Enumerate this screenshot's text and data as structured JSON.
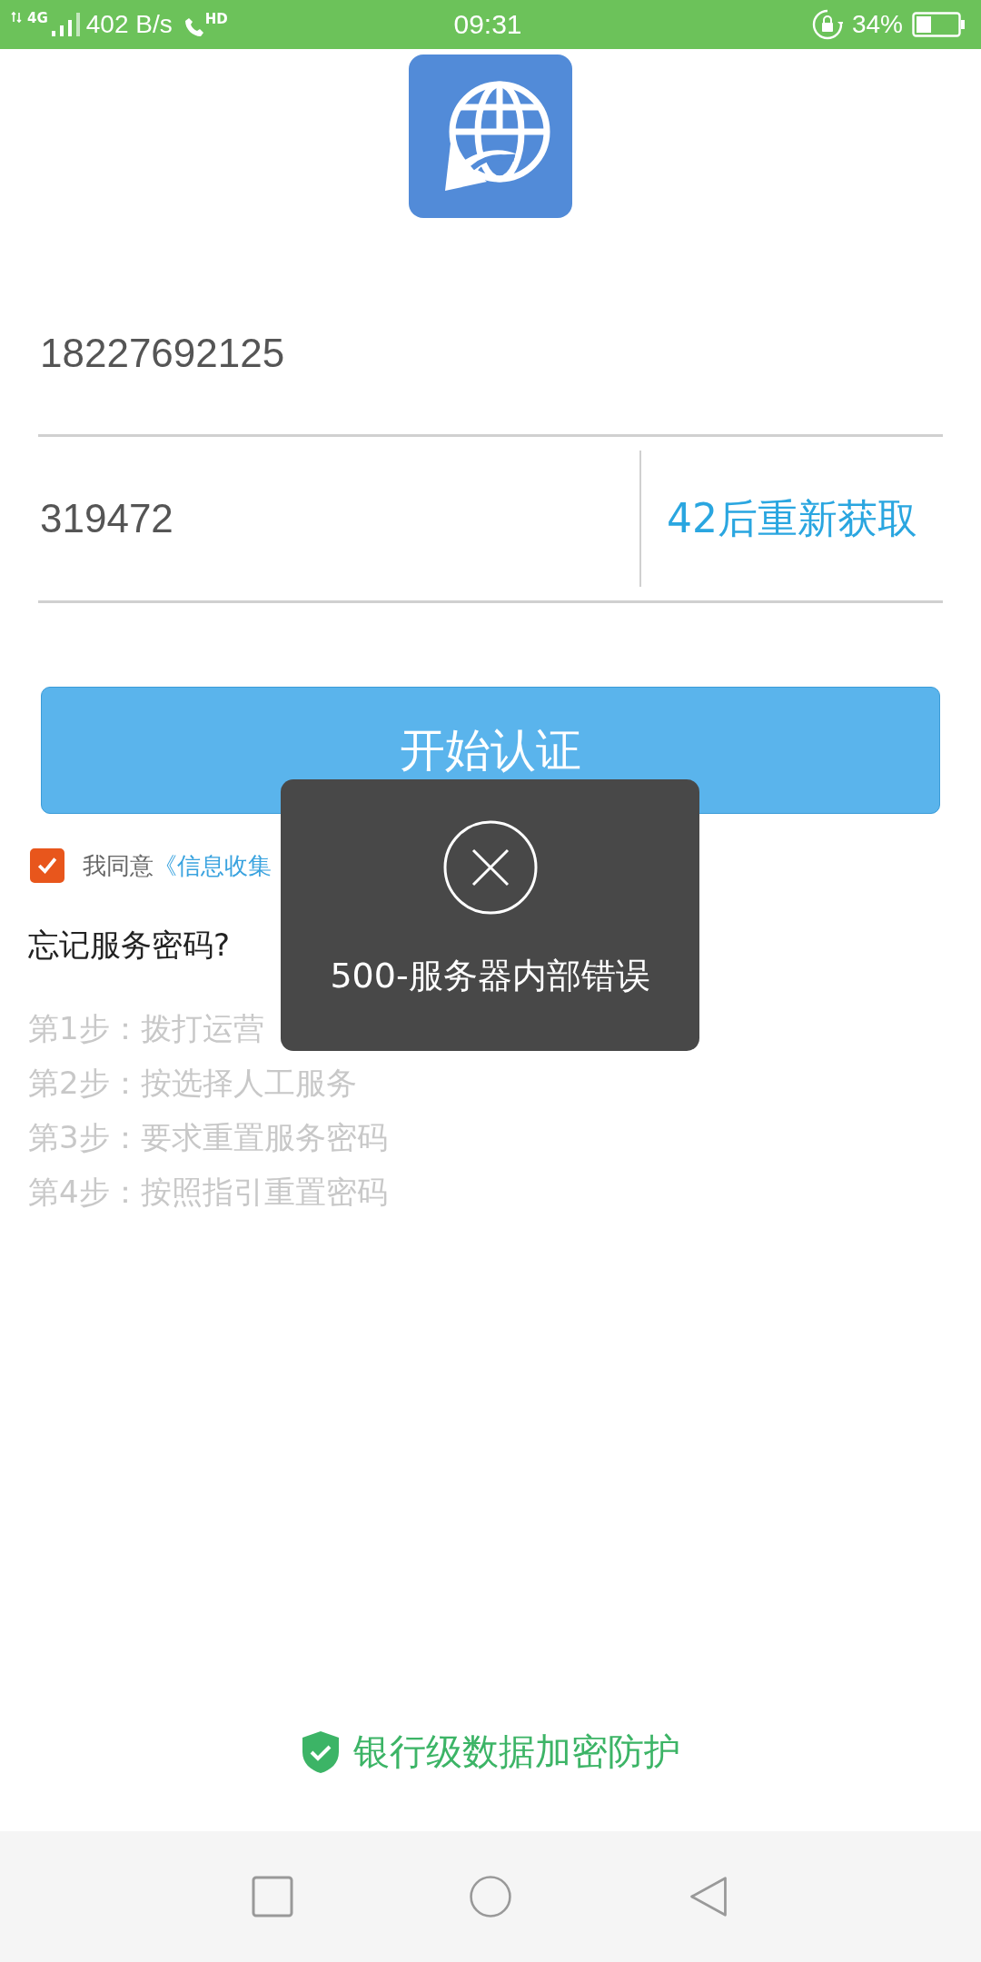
{
  "status_bar": {
    "network": "4G",
    "speed": "402 B/s",
    "call_badge": "HD",
    "time": "09:31",
    "battery": "34%"
  },
  "phone_field": {
    "value": "18227692125"
  },
  "code_field": {
    "value": "319472"
  },
  "resend_button": {
    "label": "42后重新获取"
  },
  "submit_button": {
    "label": "开始认证"
  },
  "agreement": {
    "checked": true,
    "text": "我同意",
    "link": "《信息收集"
  },
  "forgot": {
    "title": "忘记服务密码?",
    "steps": [
      "第1步：拨打运营",
      "第2步：按选择人工服务",
      "第3步：要求重置服务密码",
      "第4步：按照指引重置密码"
    ]
  },
  "toast": {
    "kind": "error",
    "message": "500-服务器内部错误"
  },
  "footer": {
    "text": "银行级数据加密防护"
  }
}
